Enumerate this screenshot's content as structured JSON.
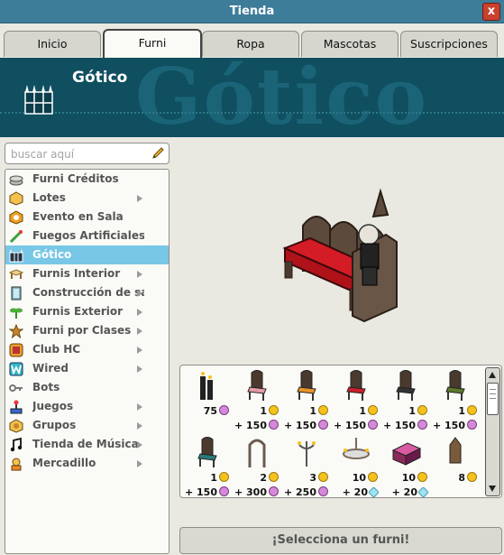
{
  "window": {
    "title": "Tienda",
    "close_glyph": "x"
  },
  "tabs": [
    {
      "label": "Inicio",
      "active": false
    },
    {
      "label": "Furni",
      "active": true
    },
    {
      "label": "Ropa",
      "active": false
    },
    {
      "label": "Mascotas",
      "active": false
    },
    {
      "label": "Suscripciones",
      "active": false
    }
  ],
  "banner": {
    "title": "Gótico",
    "background_text": "Gótico",
    "icon": "gothic-gate-icon"
  },
  "search": {
    "placeholder": "buscar aquí",
    "value": "",
    "icon": "pencil-icon"
  },
  "nav": [
    {
      "label": "Furni Créditos",
      "icon": "coins-icon",
      "arrow": false,
      "active": false
    },
    {
      "label": "Lotes",
      "icon": "box-icon",
      "arrow": true,
      "active": false
    },
    {
      "label": "Evento en Sala",
      "icon": "event-icon",
      "arrow": false,
      "active": false
    },
    {
      "label": "Fuegos Artificiales",
      "icon": "firework-icon",
      "arrow": false,
      "active": false
    },
    {
      "label": "Gótico",
      "icon": "gothic-gate-icon",
      "arrow": false,
      "active": true
    },
    {
      "label": "Furnis Interior",
      "icon": "table-icon",
      "arrow": true,
      "active": false
    },
    {
      "label": "Construcción de sala",
      "icon": "frame-icon",
      "arrow": true,
      "active": false
    },
    {
      "label": "Furnis Exterior",
      "icon": "plant-icon",
      "arrow": true,
      "active": false
    },
    {
      "label": "Furni por Clases",
      "icon": "star-icon",
      "arrow": true,
      "active": false
    },
    {
      "label": "Club HC",
      "icon": "hc-icon",
      "arrow": true,
      "active": false
    },
    {
      "label": "Wired",
      "icon": "wired-icon",
      "arrow": true,
      "active": false
    },
    {
      "label": "Bots",
      "icon": "key-icon",
      "arrow": false,
      "active": false
    },
    {
      "label": "Juegos",
      "icon": "joystick-icon",
      "arrow": true,
      "active": false
    },
    {
      "label": "Grupos",
      "icon": "groups-icon",
      "arrow": true,
      "active": false
    },
    {
      "label": "Tienda de Música",
      "icon": "music-note-icon",
      "arrow": true,
      "active": false
    },
    {
      "label": "Mercadillo",
      "icon": "marketplace-icon",
      "arrow": true,
      "active": false
    }
  ],
  "preview": {
    "item": "gothic-pew-bench-icon"
  },
  "products": [
    {
      "icon": "gothic-candles-icon",
      "line1": "75",
      "currency1": "ducket",
      "line2": "",
      "currency2": ""
    },
    {
      "icon": "chair-pink-icon",
      "line1": "1",
      "currency1": "credit",
      "line2": "+ 150",
      "currency2": "ducket"
    },
    {
      "icon": "chair-orange-icon",
      "line1": "1",
      "currency1": "credit",
      "line2": "+ 150",
      "currency2": "ducket"
    },
    {
      "icon": "chair-red-icon",
      "line1": "1",
      "currency1": "credit",
      "line2": "+ 150",
      "currency2": "ducket"
    },
    {
      "icon": "chair-black-icon",
      "line1": "1",
      "currency1": "credit",
      "line2": "+ 150",
      "currency2": "ducket"
    },
    {
      "icon": "chair-green-icon",
      "line1": "1",
      "currency1": "credit",
      "line2": "+ 150",
      "currency2": "ducket"
    },
    {
      "icon": "chair-teal-icon",
      "line1": "1",
      "currency1": "credit",
      "line2": "+ 150",
      "currency2": "ducket"
    },
    {
      "icon": "gothic-arch-icon",
      "line1": "2",
      "currency1": "credit",
      "line2": "+ 300",
      "currency2": "ducket"
    },
    {
      "icon": "candelabra-icon",
      "line1": "3",
      "currency1": "credit",
      "line2": "+ 250",
      "currency2": "ducket"
    },
    {
      "icon": "chandelier-icon",
      "line1": "10",
      "currency1": "credit",
      "line2": "+ 20",
      "currency2": "diamond"
    },
    {
      "icon": "gothic-bed-icon",
      "line1": "10",
      "currency1": "credit",
      "line2": "+ 20",
      "currency2": "diamond"
    },
    {
      "icon": "lantern-icon",
      "line1": "8",
      "currency1": "credit",
      "line2": "",
      "currency2": ""
    }
  ],
  "colors": {
    "titlebar": "#3d7d9a",
    "banner": "#0f4f60",
    "active_nav": "#79c7e6",
    "credit": "#f5c21b",
    "ducket": "#d48ad8",
    "diamond": "#9ee3f2"
  },
  "select_button": {
    "label": "¡Selecciona un furni!"
  }
}
